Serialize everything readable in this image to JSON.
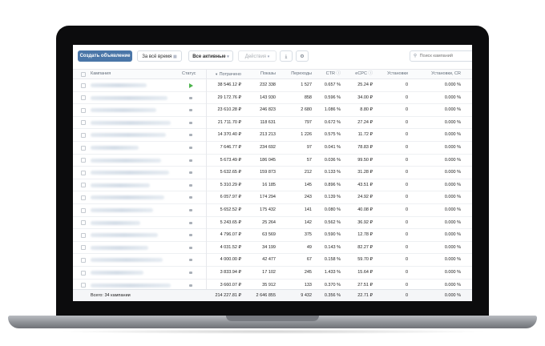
{
  "toolbar": {
    "create_button": "Создать объявление",
    "period": "За всё время",
    "filter": "Все активные",
    "actions": "Действия",
    "download_icon": "download-icon",
    "settings_icon": "gear-icon",
    "search_placeholder": "Поиск кампаний"
  },
  "columns": [
    "Кампания",
    "Статус",
    "Потрачено",
    "Показы",
    "Переходы",
    "CTR",
    "eCPC",
    "Установки",
    "Установки, CR"
  ],
  "rows": [
    {
      "status": "active",
      "spent": "38 546.12 ₽",
      "impressions": "232 338",
      "clicks": "1 527",
      "ctr": "0.657 %",
      "ecpc": "25.24 ₽",
      "installs": "0",
      "cr": "0.000 %"
    },
    {
      "status": "stopped",
      "spent": "29 172.76 ₽",
      "impressions": "143 930",
      "clicks": "858",
      "ctr": "0.596 %",
      "ecpc": "34.00 ₽",
      "installs": "0",
      "cr": "0.000 %"
    },
    {
      "status": "stopped",
      "spent": "23 610.28 ₽",
      "impressions": "246 823",
      "clicks": "2 680",
      "ctr": "1.086 %",
      "ecpc": "8.80 ₽",
      "installs": "0",
      "cr": "0.000 %"
    },
    {
      "status": "stopped",
      "spent": "21 711.70 ₽",
      "impressions": "118 631",
      "clicks": "797",
      "ctr": "0.672 %",
      "ecpc": "27.24 ₽",
      "installs": "0",
      "cr": "0.000 %"
    },
    {
      "status": "stopped",
      "spent": "14 370.40 ₽",
      "impressions": "213 213",
      "clicks": "1 226",
      "ctr": "0.575 %",
      "ecpc": "11.72 ₽",
      "installs": "0",
      "cr": "0.000 %"
    },
    {
      "status": "stopped",
      "spent": "7 646.77 ₽",
      "impressions": "234 692",
      "clicks": "97",
      "ctr": "0.041 %",
      "ecpc": "78.83 ₽",
      "installs": "0",
      "cr": "0.000 %"
    },
    {
      "status": "stopped",
      "spent": "5 673.49 ₽",
      "impressions": "186 045",
      "clicks": "57",
      "ctr": "0.036 %",
      "ecpc": "99.50 ₽",
      "installs": "0",
      "cr": "0.000 %"
    },
    {
      "status": "stopped",
      "spent": "5 632.65 ₽",
      "impressions": "159 873",
      "clicks": "212",
      "ctr": "0.133 %",
      "ecpc": "31.28 ₽",
      "installs": "0",
      "cr": "0.000 %"
    },
    {
      "status": "stopped",
      "spent": "5 310.29 ₽",
      "impressions": "16 185",
      "clicks": "145",
      "ctr": "0.896 %",
      "ecpc": "43.51 ₽",
      "installs": "0",
      "cr": "0.000 %"
    },
    {
      "status": "stopped",
      "spent": "6 057.97 ₽",
      "impressions": "174 294",
      "clicks": "243",
      "ctr": "0.139 %",
      "ecpc": "24.92 ₽",
      "installs": "0",
      "cr": "0.000 %"
    },
    {
      "status": "stopped",
      "spent": "5 652.52 ₽",
      "impressions": "175 432",
      "clicks": "141",
      "ctr": "0.080 %",
      "ecpc": "40.08 ₽",
      "installs": "0",
      "cr": "0.000 %"
    },
    {
      "status": "stopped",
      "spent": "5 243.65 ₽",
      "impressions": "25 264",
      "clicks": "142",
      "ctr": "0.562 %",
      "ecpc": "36.92 ₽",
      "installs": "0",
      "cr": "0.000 %"
    },
    {
      "status": "stopped",
      "spent": "4 796.07 ₽",
      "impressions": "63 569",
      "clicks": "375",
      "ctr": "0.590 %",
      "ecpc": "12.78 ₽",
      "installs": "0",
      "cr": "0.000 %"
    },
    {
      "status": "stopped",
      "spent": "4 031.52 ₽",
      "impressions": "34 199",
      "clicks": "49",
      "ctr": "0.143 %",
      "ecpc": "82.27 ₽",
      "installs": "0",
      "cr": "0.000 %"
    },
    {
      "status": "stopped",
      "spent": "4 000.00 ₽",
      "impressions": "42 477",
      "clicks": "67",
      "ctr": "0.158 %",
      "ecpc": "59.70 ₽",
      "installs": "0",
      "cr": "0.000 %"
    },
    {
      "status": "stopped",
      "spent": "3 833.94 ₽",
      "impressions": "17 102",
      "clicks": "245",
      "ctr": "1.433 %",
      "ecpc": "15.64 ₽",
      "installs": "0",
      "cr": "0.000 %"
    },
    {
      "status": "stopped",
      "spent": "3 660.07 ₽",
      "impressions": "35 912",
      "clicks": "133",
      "ctr": "0.370 %",
      "ecpc": "27.51 ₽",
      "installs": "0",
      "cr": "0.000 %"
    }
  ],
  "totals": {
    "label": "Всего: 34 кампании",
    "spent": "214 227.81 ₽",
    "impressions": "2 646 855",
    "clicks": "9 432",
    "ctr": "0.356 %",
    "ecpc": "22.71 ₽",
    "installs": "0",
    "cr": "0.000 %"
  }
}
